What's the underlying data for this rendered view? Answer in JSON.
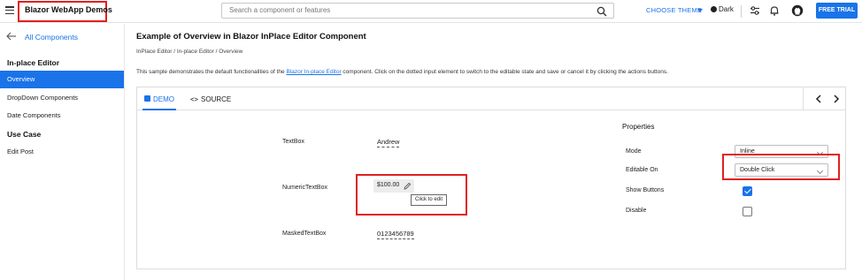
{
  "header": {
    "app_title": "Blazor WebApp Demos",
    "search_placeholder": "Search a component or features",
    "choose_theme": "CHOOSE THEME",
    "dark_label": "Dark",
    "free_trial": "FREE TRIAL",
    "icons": [
      "menu-icon",
      "search-icon",
      "caret-down-icon",
      "moon-icon",
      "settings-sliders-icon",
      "bell-icon",
      "github-icon"
    ]
  },
  "sidebar": {
    "back_label": "All Components",
    "sections": [
      {
        "heading": "In-place Editor",
        "items": [
          "Overview",
          "DropDown Components",
          "Date Components"
        ]
      },
      {
        "heading": "Use Case",
        "items": [
          "Edit Post"
        ]
      }
    ],
    "active_item": "Overview"
  },
  "main": {
    "title": "Example of Overview in Blazor InPlace Editor Component",
    "breadcrumb": "InPlace Editor / In-place Editor / Overview",
    "description_before": "This sample demonstrates the default functionalities of the ",
    "description_link": "Blazor In-place Editor",
    "description_after": " component. Click on the dotted input element to switch to the editable state and save or cancel it by clicking the actions buttons.",
    "tabs": {
      "demo": "DEMO",
      "source": "SOURCE"
    }
  },
  "demo": {
    "fields": [
      {
        "label": "TextBox",
        "value": "Andrew"
      },
      {
        "label": "NumericTextBox",
        "value": "$100.00"
      },
      {
        "label": "MaskedTextBox",
        "value": "0123456789"
      }
    ],
    "tooltip": "Click to edit"
  },
  "properties": {
    "title": "Properties",
    "mode_label": "Mode",
    "mode_value": "Inline",
    "editable_on_label": "Editable On",
    "editable_on_value": "Double Click",
    "show_buttons_label": "Show Buttons",
    "show_buttons_checked": true,
    "disable_label": "Disable",
    "disable_checked": false
  },
  "colors": {
    "accent": "#1a73e8",
    "highlight_box": "#e02020"
  }
}
